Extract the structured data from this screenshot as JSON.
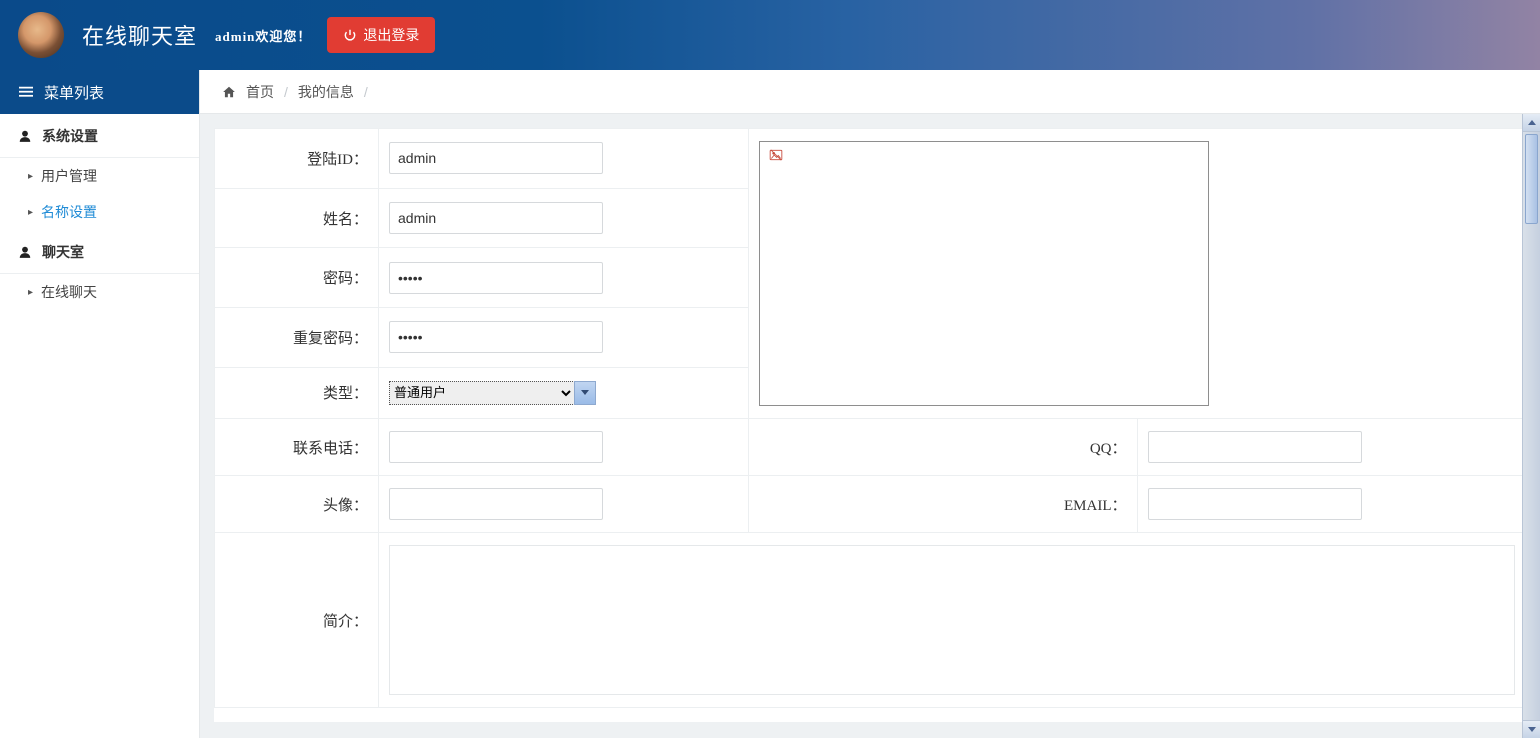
{
  "header": {
    "app_title": "在线聊天室",
    "welcome_text": "admin欢迎您！",
    "logout_label": "退出登录"
  },
  "sidebar": {
    "menu_header": "菜单列表",
    "sections": [
      {
        "title": "系统设置",
        "items": [
          "用户管理",
          "名称设置"
        ],
        "active_index": 1
      },
      {
        "title": "聊天室",
        "items": [
          "在线聊天"
        ],
        "active_index": -1
      }
    ]
  },
  "breadcrumb": {
    "home": "首页",
    "current": "我的信息"
  },
  "form": {
    "login_id": {
      "label": "登陆ID：",
      "value": "admin"
    },
    "name": {
      "label": "姓名：",
      "value": "admin"
    },
    "password": {
      "label": "密码：",
      "value": "*****"
    },
    "password_repeat": {
      "label": "重复密码：",
      "value": "*****"
    },
    "type": {
      "label": "类型：",
      "selected": "普通用户",
      "options": [
        "普通用户"
      ]
    },
    "phone": {
      "label": "联系电话：",
      "value": ""
    },
    "qq": {
      "label": "QQ：",
      "value": ""
    },
    "avatar": {
      "label": "头像：",
      "value": ""
    },
    "email": {
      "label": "EMAIL：",
      "value": ""
    },
    "intro": {
      "label": "简介：",
      "value": ""
    }
  }
}
